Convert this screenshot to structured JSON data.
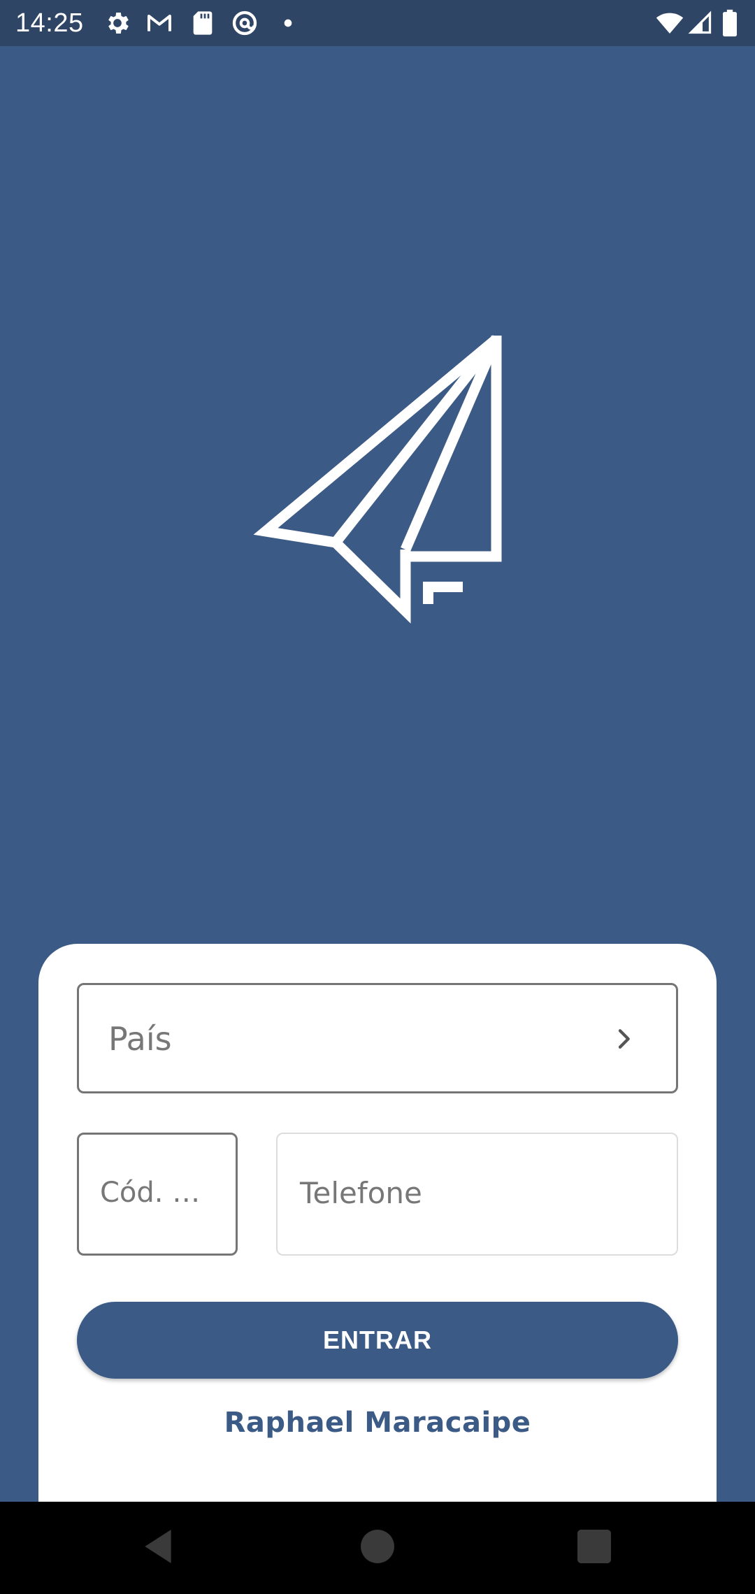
{
  "status_bar": {
    "time": "14:25",
    "left_icons": [
      "gear-icon",
      "gmail-icon",
      "sd-card-icon",
      "at-sign-icon",
      "dot-icon"
    ],
    "right_icons": [
      "wifi-icon",
      "signal-icon",
      "battery-icon"
    ]
  },
  "logo": {
    "icon": "paper-plane-icon",
    "color": "#ffffff"
  },
  "form": {
    "country_placeholder": "País",
    "code_placeholder": "Cód. …",
    "phone_placeholder": "Telefone",
    "enter_label": "ENTRAR",
    "author": "Raphael Maracaipe"
  },
  "colors": {
    "background": "#3b5b86",
    "status_bar": "#2e4566",
    "card": "#ffffff",
    "button": "#3b5b86",
    "author_text": "#3b5b86"
  },
  "nav_bar": {
    "buttons": [
      "back-icon",
      "home-icon",
      "recents-icon"
    ]
  }
}
